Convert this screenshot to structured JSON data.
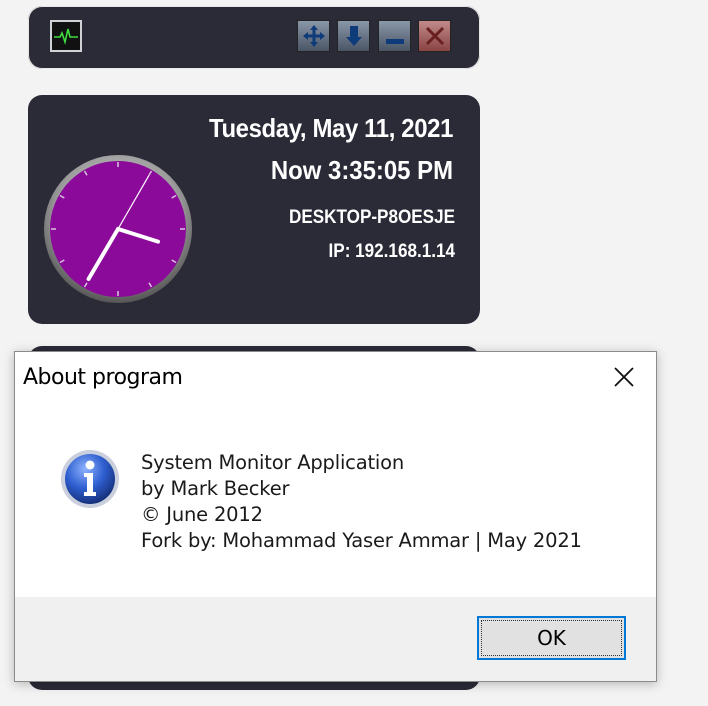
{
  "toolbar": {
    "app_icon": "heartbeat-monitor-icon",
    "buttons": [
      {
        "icon": "move-icon"
      },
      {
        "icon": "arrow-down-icon"
      },
      {
        "icon": "minimize-icon"
      },
      {
        "icon": "close-icon"
      }
    ]
  },
  "clock_widget": {
    "date": "Tuesday, May 11, 2021",
    "time": "Now 3:35:05 PM",
    "hostname": "DESKTOP-P8OESJE",
    "ip": "IP: 192.168.1.14",
    "face_color": "#8b0a9a",
    "clock_time": {
      "hour": 3,
      "minute": 35,
      "second": 5
    }
  },
  "dialog": {
    "title": "About program",
    "icon": "info-icon",
    "lines": [
      "System Monitor Application",
      "by Mark Becker",
      "© June 2012",
      "Fork by: Mohammad Yaser Ammar | May 2021"
    ],
    "ok_label": "OK",
    "accent": "#0078d7"
  }
}
